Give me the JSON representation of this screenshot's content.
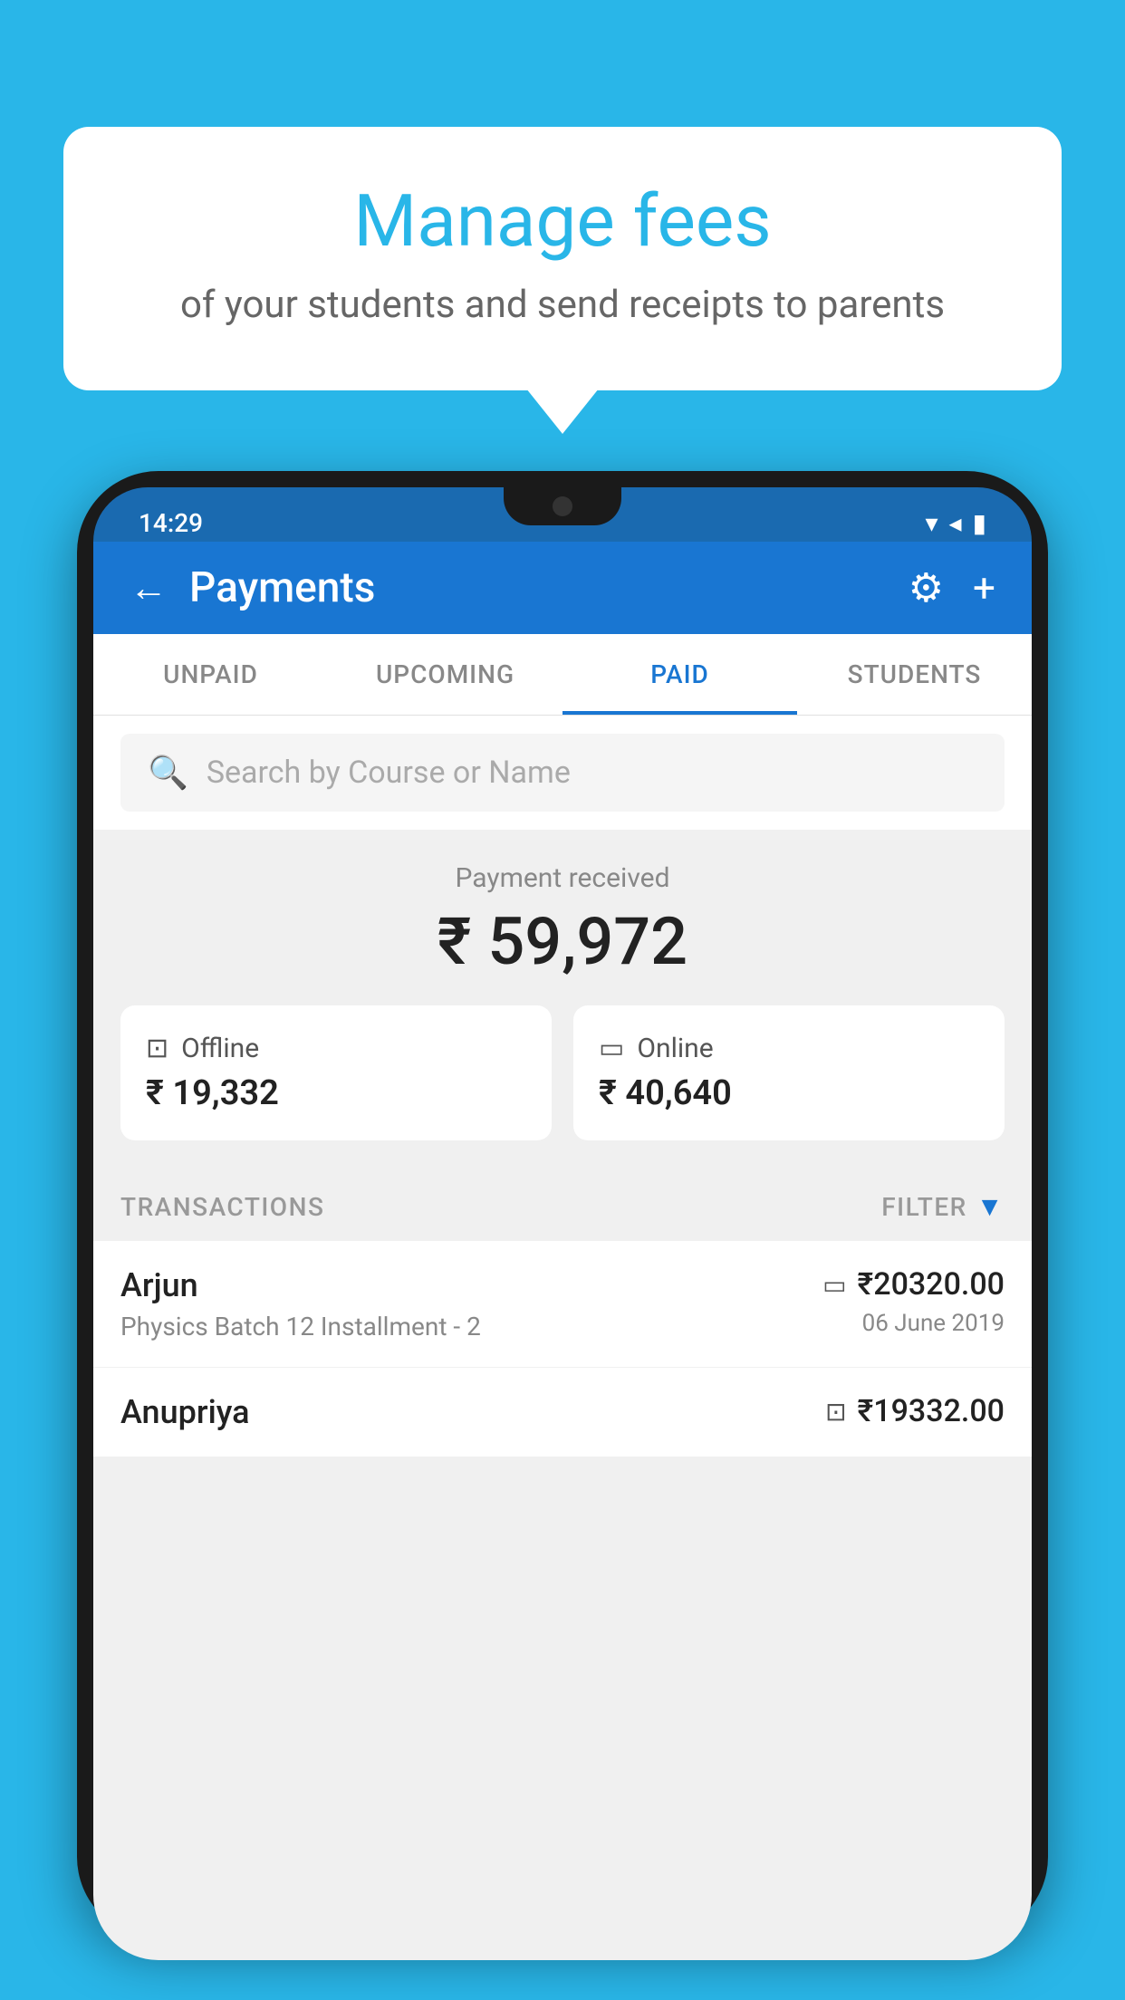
{
  "background_color": "#29b6e8",
  "speech_bubble": {
    "title": "Manage fees",
    "subtitle": "of your students and send receipts to parents"
  },
  "status_bar": {
    "time": "14:29",
    "wifi": "▼",
    "signal": "◀",
    "battery": "▮"
  },
  "header": {
    "title": "Payments",
    "back_label": "←",
    "gear_label": "⚙",
    "plus_label": "+"
  },
  "tabs": [
    {
      "label": "UNPAID",
      "active": false
    },
    {
      "label": "UPCOMING",
      "active": false
    },
    {
      "label": "PAID",
      "active": true
    },
    {
      "label": "STUDENTS",
      "active": false
    }
  ],
  "search": {
    "placeholder": "Search by Course or Name"
  },
  "payment_received": {
    "label": "Payment received",
    "amount": "₹ 59,972"
  },
  "payment_cards": {
    "offline": {
      "label": "Offline",
      "amount": "₹ 19,332"
    },
    "online": {
      "label": "Online",
      "amount": "₹ 40,640"
    }
  },
  "transactions": {
    "section_label": "TRANSACTIONS",
    "filter_label": "FILTER",
    "rows": [
      {
        "name": "Arjun",
        "course": "Physics Batch 12 Installment - 2",
        "amount": "₹20320.00",
        "date": "06 June 2019",
        "payment_type": "card"
      },
      {
        "name": "Anupriya",
        "course": "",
        "amount": "₹19332.00",
        "date": "",
        "payment_type": "offline"
      }
    ]
  }
}
